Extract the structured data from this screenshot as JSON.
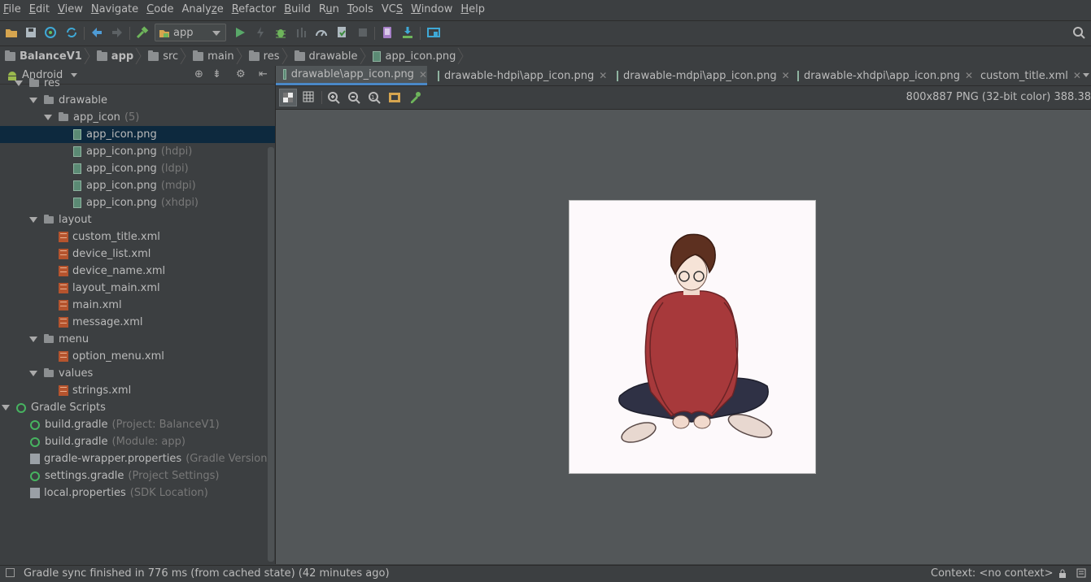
{
  "menu": [
    {
      "label": "File",
      "u": "F"
    },
    {
      "label": "Edit",
      "u": "E"
    },
    {
      "label": "View",
      "u": "V"
    },
    {
      "label": "Navigate",
      "u": "N"
    },
    {
      "label": "Code",
      "u": "C"
    },
    {
      "label": "Analyze",
      "u": "z"
    },
    {
      "label": "Refactor",
      "u": "R"
    },
    {
      "label": "Build",
      "u": "B"
    },
    {
      "label": "Run",
      "u": "u"
    },
    {
      "label": "Tools",
      "u": "T"
    },
    {
      "label": "VCS",
      "u": "S"
    },
    {
      "label": "Window",
      "u": "W"
    },
    {
      "label": "Help",
      "u": "H"
    }
  ],
  "toolbar": {
    "run_config": "app",
    "icons": [
      "open-icon",
      "save-icon",
      "sync-icon",
      "sync-refresh-icon",
      "back-icon",
      "forward-icon",
      "make-hammer-icon",
      "run-icon",
      "apply-changes-icon",
      "debug-icon",
      "attach-debugger-icon",
      "profile-icon",
      "gradle-sync-icon",
      "stop-icon",
      "avd-manager-icon",
      "sdk-manager-icon",
      "project-structure-icon",
      "search-icon"
    ]
  },
  "breadcrumb": [
    "BalanceV1",
    "app",
    "src",
    "main",
    "res",
    "drawable",
    "app_icon.png"
  ],
  "project_panel": {
    "view_label": "Android"
  },
  "tree": [
    {
      "label": "res",
      "hint": "",
      "indent": 0,
      "type": "folder-res",
      "expanded": true
    },
    {
      "label": "drawable",
      "hint": "",
      "indent": 1,
      "type": "folder",
      "expanded": true
    },
    {
      "label": "app_icon",
      "hint": "(5)",
      "indent": 2,
      "type": "folder",
      "expanded": true
    },
    {
      "label": "app_icon.png",
      "hint": "",
      "indent": 3,
      "type": "image",
      "selected": true
    },
    {
      "label": "app_icon.png",
      "hint": "(hdpi)",
      "indent": 3,
      "type": "image"
    },
    {
      "label": "app_icon.png",
      "hint": "(ldpi)",
      "indent": 3,
      "type": "image"
    },
    {
      "label": "app_icon.png",
      "hint": "(mdpi)",
      "indent": 3,
      "type": "image"
    },
    {
      "label": "app_icon.png",
      "hint": "(xhdpi)",
      "indent": 3,
      "type": "image"
    },
    {
      "label": "layout",
      "hint": "",
      "indent": 1,
      "type": "folder",
      "expanded": true
    },
    {
      "label": "custom_title.xml",
      "hint": "",
      "indent": 2,
      "type": "xml"
    },
    {
      "label": "device_list.xml",
      "hint": "",
      "indent": 2,
      "type": "xml"
    },
    {
      "label": "device_name.xml",
      "hint": "",
      "indent": 2,
      "type": "xml"
    },
    {
      "label": "layout_main.xml",
      "hint": "",
      "indent": 2,
      "type": "xml"
    },
    {
      "label": "main.xml",
      "hint": "",
      "indent": 2,
      "type": "xml"
    },
    {
      "label": "message.xml",
      "hint": "",
      "indent": 2,
      "type": "xml"
    },
    {
      "label": "menu",
      "hint": "",
      "indent": 1,
      "type": "folder",
      "expanded": true
    },
    {
      "label": "option_menu.xml",
      "hint": "",
      "indent": 2,
      "type": "xml"
    },
    {
      "label": "values",
      "hint": "",
      "indent": 1,
      "type": "folder",
      "expanded": true
    },
    {
      "label": "strings.xml",
      "hint": "",
      "indent": 2,
      "type": "xml"
    },
    {
      "label": "Gradle Scripts",
      "hint": "",
      "indent": -1,
      "type": "gradle-root",
      "expanded": true
    },
    {
      "label": "build.gradle",
      "hint": "(Project: BalanceV1)",
      "indent": 0,
      "type": "gradle"
    },
    {
      "label": "build.gradle",
      "hint": "(Module: app)",
      "indent": 0,
      "type": "gradle"
    },
    {
      "label": "gradle-wrapper.properties",
      "hint": "(Gradle Version)",
      "indent": 0,
      "type": "props"
    },
    {
      "label": "settings.gradle",
      "hint": "(Project Settings)",
      "indent": 0,
      "type": "gradle"
    },
    {
      "label": "local.properties",
      "hint": "(SDK Location)",
      "indent": 0,
      "type": "props"
    }
  ],
  "tabs": [
    {
      "label": "drawable\\app_icon.png",
      "active": true,
      "type": "image"
    },
    {
      "label": "drawable-hdpi\\app_icon.png",
      "active": false,
      "type": "image"
    },
    {
      "label": "drawable-mdpi\\app_icon.png",
      "active": false,
      "type": "image"
    },
    {
      "label": "drawable-xhdpi\\app_icon.png",
      "active": false,
      "type": "image"
    },
    {
      "label": "custom_title.xml",
      "active": false,
      "type": "xml"
    }
  ],
  "image_info": "800x887 PNG (32-bit color) 388.38",
  "status": {
    "message": "Gradle sync finished in 776 ms (from cached state) (42 minutes ago)",
    "context": "Context: <no context>"
  },
  "colors": {
    "selection": "#0d293e",
    "accent": "#4a88c7",
    "editor_bg": "#535759"
  }
}
